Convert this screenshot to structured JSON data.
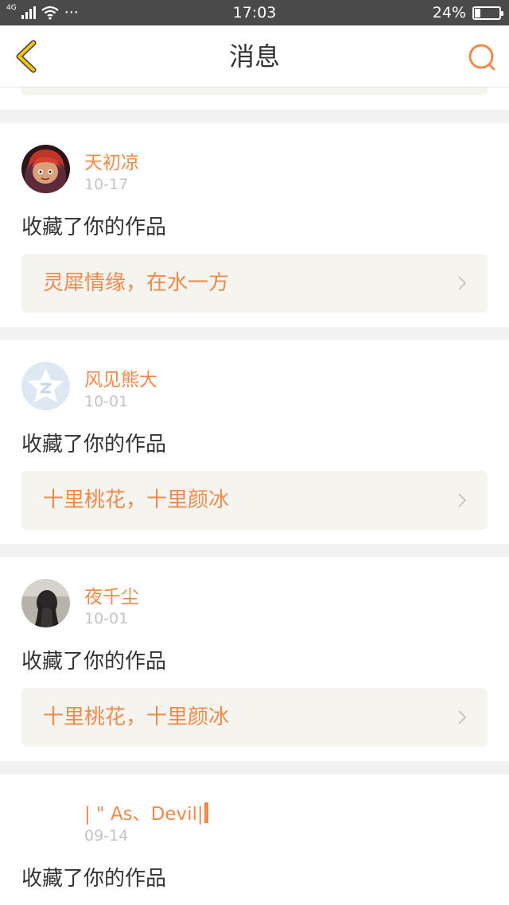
{
  "status_bar": {
    "network": "4G",
    "dots": "···",
    "time": "17:03",
    "battery_text": "24%",
    "battery_level": 0.24
  },
  "navbar": {
    "title": "消息",
    "back_icon": "chevron-left-icon",
    "search_icon": "search-icon"
  },
  "notifications": [
    {
      "username": "天初凉",
      "date": "10-17",
      "action": "收藏了你的作品",
      "work_title": "灵犀情缘，在水一方",
      "avatar": "red-hair-character-avatar"
    },
    {
      "username": "风见熊大",
      "date": "10-01",
      "action": "收藏了你的作品",
      "work_title": "十里桃花，十里颜冰",
      "avatar": "qq-default-avatar"
    },
    {
      "username": "夜千尘",
      "date": "10-01",
      "action": "收藏了你的作品",
      "work_title": "十里桃花，十里颜冰",
      "avatar": "photo-avatar"
    },
    {
      "username": "| \" As、Devil|",
      "date": "09-14",
      "action": "收藏了你的作品",
      "work_title": "",
      "avatar": "blank-avatar"
    }
  ],
  "colors": {
    "accent": "#f08a4b",
    "back_icon": "#f5c400",
    "status_bar": "#4a4a4a",
    "page_bg": "#f2f2f2",
    "work_bg": "#f5f4ee"
  }
}
